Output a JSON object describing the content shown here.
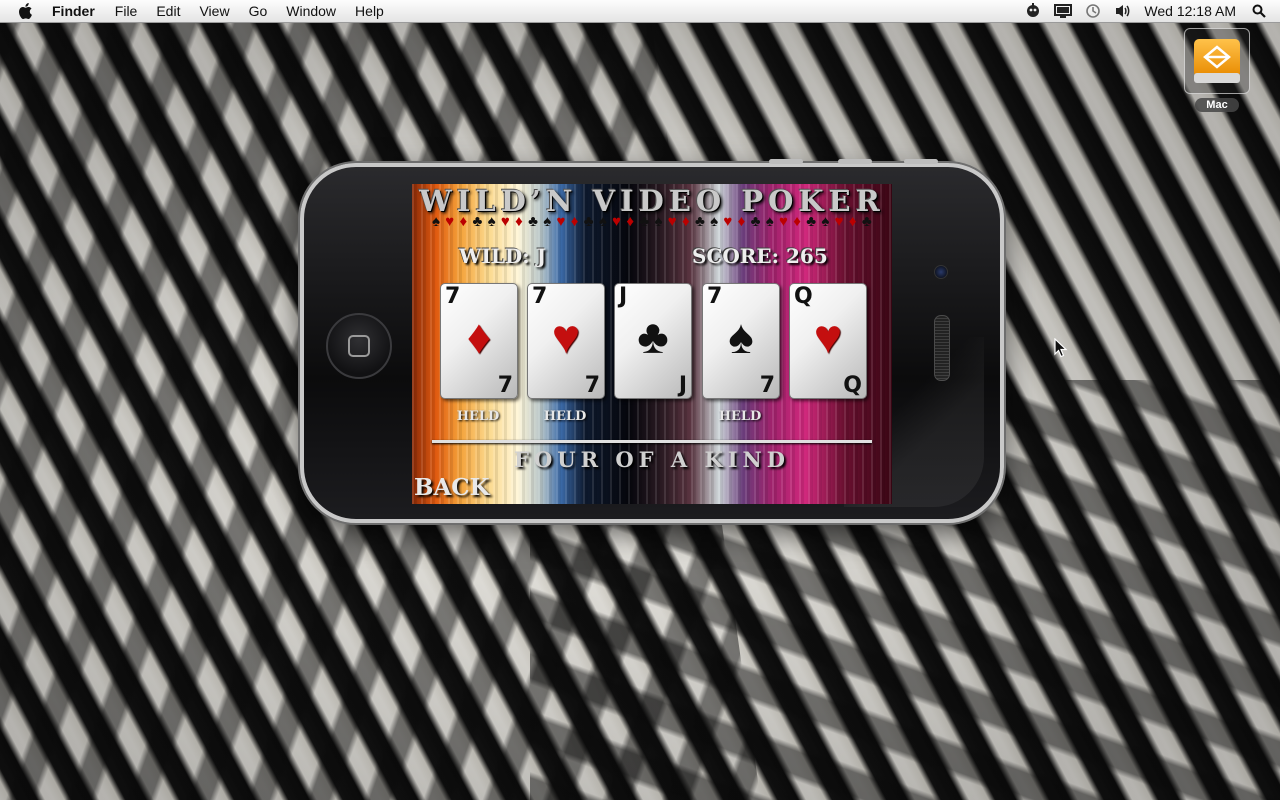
{
  "menubar": {
    "app_name": "Finder",
    "items": [
      "File",
      "Edit",
      "View",
      "Go",
      "Window",
      "Help"
    ],
    "clock": "Wed 12:18 AM"
  },
  "desktop": {
    "drive_label": "Mac"
  },
  "game": {
    "title": "WILD’N VIDEO POKER",
    "wild_label": "WILD: J",
    "score_label": "SCORE: 265",
    "cards": [
      {
        "rank": "7",
        "suit": "♦",
        "color": "red",
        "held": "HELD"
      },
      {
        "rank": "7",
        "suit": "♥",
        "color": "red",
        "held": "HELD"
      },
      {
        "rank": "J",
        "suit": "♣",
        "color": "black",
        "held": ""
      },
      {
        "rank": "7",
        "suit": "♠",
        "color": "black",
        "held": "HELD"
      },
      {
        "rank": "Q",
        "suit": "♥",
        "color": "red",
        "held": ""
      }
    ],
    "result": "FOUR OF A KIND",
    "back_label": "BACK",
    "suit_strip": [
      "♠",
      "♥",
      "♦",
      "♣",
      "♠",
      "♥",
      "♦",
      "♣",
      "♠",
      "♥",
      "♦",
      "♣",
      "♠",
      "♥",
      "♦",
      "♣",
      "♠",
      "♥",
      "♦",
      "♣",
      "♠",
      "♥",
      "♦",
      "♣",
      "♠",
      "♥",
      "♦",
      "♣",
      "♠",
      "♥",
      "♦",
      "♣"
    ]
  }
}
